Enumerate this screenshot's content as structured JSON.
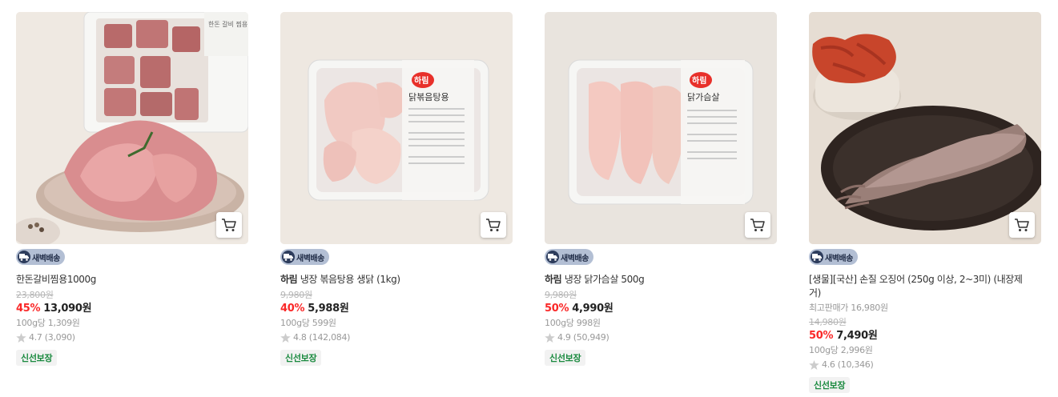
{
  "colors": {
    "discount": "#fa2828",
    "fresh_tag": "#1a8a3f",
    "badge_bg": "#b3bfd4",
    "muted": "#999999"
  },
  "icons": {
    "cart": "cart-icon",
    "star": "star-icon",
    "delivery": "truck-icon"
  },
  "products": [
    {
      "badge": "새벽배송",
      "brand": "",
      "name": "한돈갈비찜용1000g",
      "best_price": "",
      "original_price": "23,800원",
      "discount": "45%",
      "price": "13,090원",
      "unit_price": "100g당 1,309원",
      "rating": "4.7",
      "review_count": "(3,090)",
      "tag": "신선보장",
      "package_label": "한돈 갈비 찜용"
    },
    {
      "badge": "새벽배송",
      "brand": "하림",
      "name": "냉장 볶음탕용 생닭 (1kg)",
      "best_price": "",
      "original_price": "9,980원",
      "discount": "40%",
      "price": "5,988원",
      "unit_price": "100g당 599원",
      "rating": "4.8",
      "review_count": "(142,084)",
      "tag": "신선보장",
      "package_brand": "하림",
      "package_label": "닭볶음탕용"
    },
    {
      "badge": "새벽배송",
      "brand": "하림",
      "name": "냉장 닭가슴살 500g",
      "best_price": "",
      "original_price": "9,980원",
      "discount": "50%",
      "price": "4,990원",
      "unit_price": "100g당 998원",
      "rating": "4.9",
      "review_count": "(50,949)",
      "tag": "신선보장",
      "package_brand": "하림",
      "package_label": "닭가슴살"
    },
    {
      "badge": "새벽배송",
      "brand": "",
      "name": "[생물][국산] 손질 오징어 (250g 이상, 2~3미) (내장제거)",
      "best_price": "최고판매가 16,980원",
      "original_price": "14,980원",
      "discount": "50%",
      "price": "7,490원",
      "unit_price": "100g당 2,996원",
      "rating": "4.6",
      "review_count": "(10,346)",
      "tag": "신선보장"
    }
  ]
}
